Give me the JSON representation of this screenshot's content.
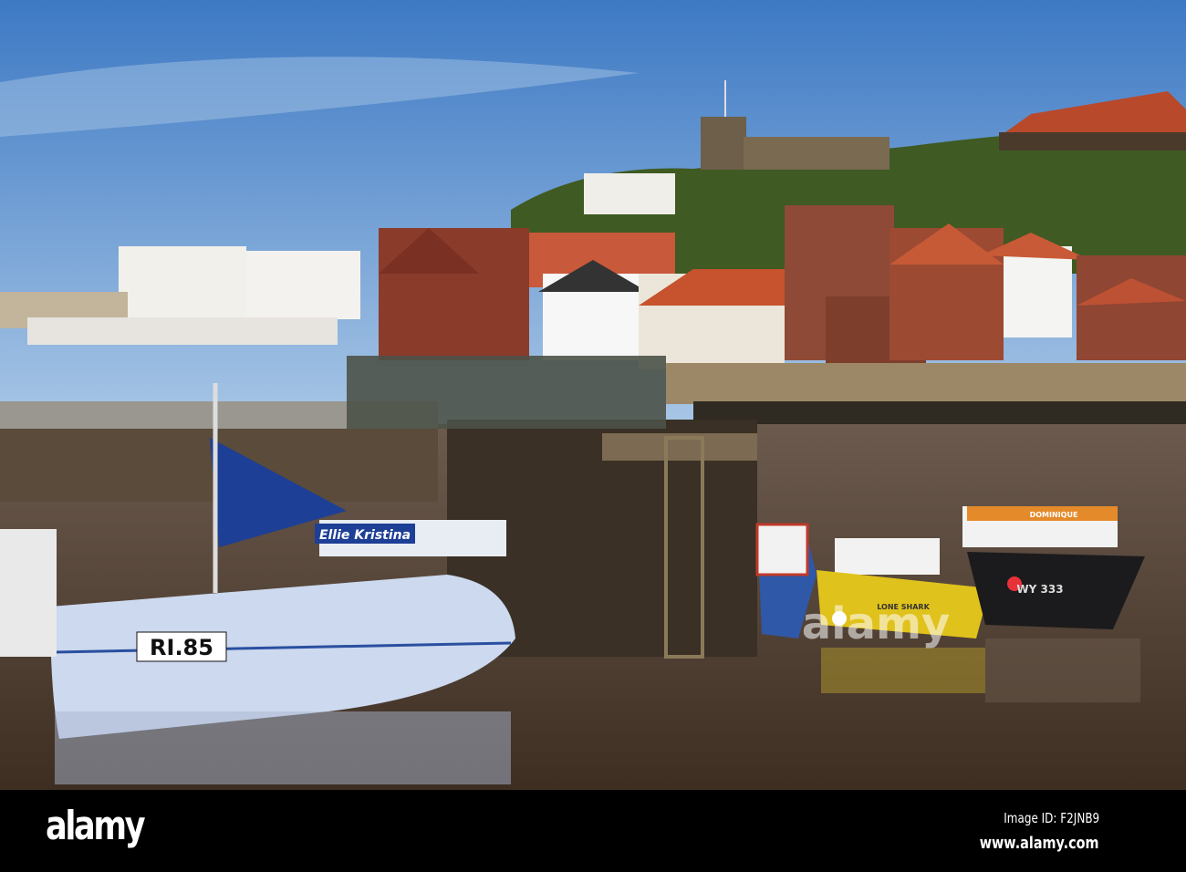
{
  "photo": {
    "boats": {
      "main_registration": "RI.85",
      "main_name": "Ellie Kristina",
      "black_boat_registration": "WY 333",
      "black_boat_name": "DOMINIQUE",
      "yellow_boat_name": "LONE SHARK"
    },
    "colors": {
      "sky_top": "#3d79c4",
      "sky_bottom": "#a9c7e6",
      "water": "#4a382b",
      "roof": "#c4532e",
      "hull_blue": "#2f58a8",
      "sail_blue": "#1e3f96",
      "hull_yellow": "#e0c21c"
    }
  },
  "watermark": {
    "logo": "alamy",
    "image_id": "Image ID: F2JNB9",
    "website": "www.alamy.com"
  }
}
